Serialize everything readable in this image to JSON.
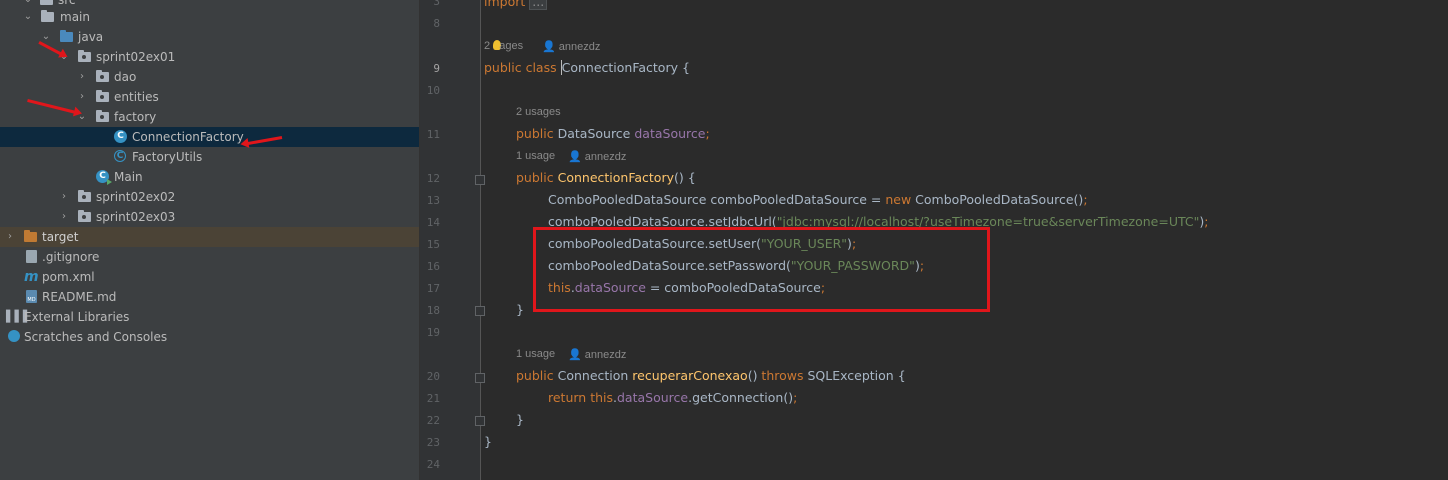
{
  "tree": {
    "items": [
      {
        "label": "src"
      },
      {
        "label": "main"
      },
      {
        "label": "java"
      },
      {
        "label": "sprint02ex01"
      },
      {
        "label": "dao"
      },
      {
        "label": "entities"
      },
      {
        "label": "factory"
      },
      {
        "label": "ConnectionFactory"
      },
      {
        "label": "FactoryUtils"
      },
      {
        "label": "Main"
      },
      {
        "label": "sprint02ex02"
      },
      {
        "label": "sprint02ex03"
      },
      {
        "label": "target"
      },
      {
        "label": ".gitignore"
      },
      {
        "label": "pom.xml"
      },
      {
        "label": "README.md"
      },
      {
        "label": "External Libraries"
      },
      {
        "label": "Scratches and Consoles"
      }
    ],
    "selected": "ConnectionFactory"
  },
  "editor": {
    "line_numbers": [
      "3",
      "8",
      "9",
      "10",
      "11",
      "12",
      "13",
      "14",
      "15",
      "16",
      "17",
      "18",
      "19",
      "20",
      "21",
      "22",
      "23",
      "24"
    ],
    "hints": {
      "h9_a": "2",
      "h9_b": "ages",
      "h9_author": "annezdz",
      "h11": "2 usages",
      "h12": "1 usage",
      "h12_author": "annezdz",
      "h20": "1 usage",
      "h20_author": "annezdz"
    },
    "code": {
      "l3_kw": "import",
      "l3_folded": "...",
      "l9_kw": "public class ",
      "l9_name": "ConnectionFactory",
      "l9_rest": " {",
      "l11_kw": "public ",
      "l11_type": "DataSource ",
      "l11_field": "dataSource",
      "l11_end": ";",
      "l12_kw": "public ",
      "l12_name": "ConnectionFactory",
      "l12_rest": "() {",
      "l13_a": "ComboPooledDataSource comboPooledDataSource = ",
      "l13_kw": "new ",
      "l13_b": "ComboPooledDataSource()",
      "l13_end": ";",
      "l14_a": "comboPooledDataSource.setJdbcUrl(",
      "l14_str": "\"jdbc:mysql://localhost/?useTimezone=true&serverTimezone=UTC\"",
      "l14_b": ")",
      "l14_end": ";",
      "l15_a": "comboPooledDataSource.setUser(",
      "l15_str": "\"YOUR_USER\"",
      "l15_b": ")",
      "l15_end": ";",
      "l16_a": "comboPooledDataSource.setPassword(",
      "l16_str": "\"YOUR_PASSWORD\"",
      "l16_b": ")",
      "l16_end": ";",
      "l17_kw": "this",
      "l17_dot": ".",
      "l17_field": "dataSource",
      "l17_b": " = comboPooledDataSource",
      "l17_end": ";",
      "l18": "}",
      "l20_kw": "public ",
      "l20_type": "Connection ",
      "l20_name": "recuperarConexao",
      "l20_b": "() ",
      "l20_kw2": "throws ",
      "l20_c": "SQLException {",
      "l21_kw": "return ",
      "l21_kw2": "this",
      "l21_dot": ".",
      "l21_field": "dataSource",
      "l21_b": ".getConnection()",
      "l21_end": ";",
      "l22": "}",
      "l23": "}"
    }
  },
  "colors": {
    "keyword": "#cc7832",
    "field": "#9876aa",
    "string": "#6a8759",
    "method": "#ffc66d",
    "annotation_red": "#e0161b",
    "selection": "#0d293e"
  }
}
